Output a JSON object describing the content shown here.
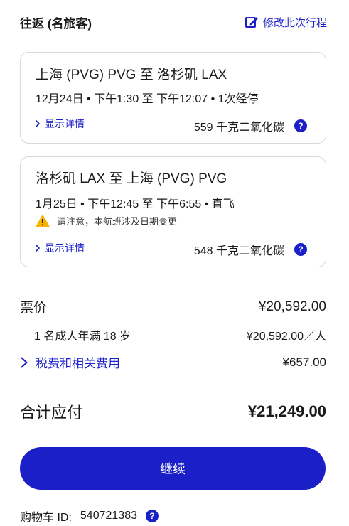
{
  "header": {
    "title": "往返 (名旅客)",
    "edit_label": "修改此次行程"
  },
  "flights": [
    {
      "route": "上海 (PVG) PVG 至 洛杉矶 LAX",
      "times": "12月24日 • 下午1:30 至 下午12:07 • 1次经停",
      "details_label": "显示详情",
      "carbon": "559 千克二氧化碳"
    },
    {
      "route": "洛杉矶 LAX 至 上海 (PVG) PVG",
      "times": "1月25日 • 下午12:45 至 下午6:55 • 直飞",
      "notice": "请注意，本航班涉及日期变更",
      "details_label": "显示详情",
      "carbon": "548 千克二氧化碳"
    }
  ],
  "price": {
    "fare_label": "票价",
    "fare_amount": "¥20,592.00",
    "adult_label": "1 名成人年满 18 岁",
    "adult_amount": "¥20,592.00／人",
    "taxes_label": "税费和相关费用",
    "taxes_amount": "¥657.00",
    "total_label": "合计应付",
    "total_amount": "¥21,249.00"
  },
  "continue_label": "继续",
  "cart": {
    "label": "购物车 ID:",
    "id": "540721383"
  },
  "colors": {
    "accent": "#1b1fc8",
    "warning": "#f5b400"
  }
}
